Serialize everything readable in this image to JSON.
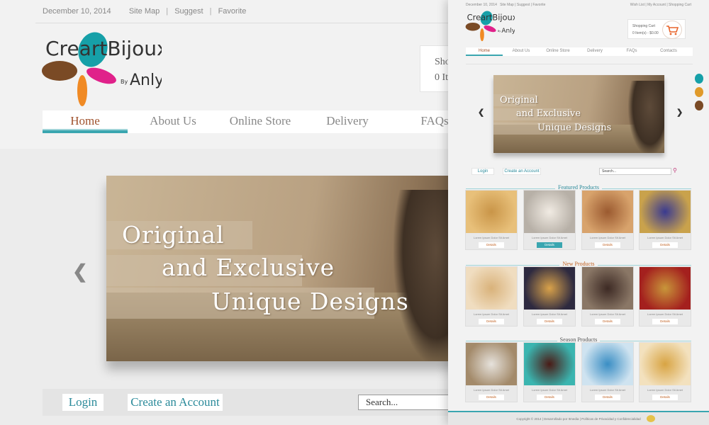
{
  "big": {
    "top_links": [
      "December 10, 2014",
      "Site Map",
      "Suggest",
      "Favorite"
    ],
    "logo": {
      "brand": "CreartBijoux",
      "by": "By",
      "author": "Anly"
    },
    "cart": {
      "label": "Shop",
      "items": "0 Ite"
    },
    "nav": [
      "Home",
      "About Us",
      "Online Store",
      "Delivery",
      "FAQs"
    ],
    "banner": {
      "line1": "Original",
      "line2": "and Exclusive",
      "line3": "Unique Designs"
    },
    "login": "Login",
    "create_account": "Create an Account",
    "search_placeholder": "Search..."
  },
  "small": {
    "top_links": [
      "December 10, 2014",
      "Site Map",
      "Suggest",
      "Favorite"
    ],
    "top_right_links": [
      "Wish List",
      "My Account",
      "Shopping Cart"
    ],
    "cart": {
      "label": "Shopping Cart",
      "items": "0 Item(s) - $0.00"
    },
    "nav": [
      "Home",
      "About Us",
      "Online Store",
      "Delivery",
      "FAQs",
      "Contacts"
    ],
    "banner": {
      "line1": "Original",
      "line2": "and Exclusive",
      "line3": "Unique Designs"
    },
    "login": "Login",
    "create_account": "Create an Account",
    "search_placeholder": "Search...",
    "sections": [
      {
        "title": "Featured Products",
        "color": "#2a8a9a",
        "products": [
          {
            "caption": "Lorem Ipsum Dolor Sit Amet",
            "details": "Details",
            "colors": [
              "#c99548",
              "#e8c07a"
            ]
          },
          {
            "caption": "Lorem Ipsum Dolor Sit Amet",
            "details": "Details",
            "colors": [
              "#f1ebe3",
              "#b7b0a7"
            ]
          },
          {
            "caption": "Lorem Ipsum Dolor Sit Amet",
            "details": "Details",
            "colors": [
              "#9b5a30",
              "#d8a36c"
            ]
          },
          {
            "caption": "Lorem Ipsum Dolor Sit Amet",
            "details": "Details",
            "colors": [
              "#3a3a90",
              "#c9a24c"
            ]
          }
        ]
      },
      {
        "title": "New Products",
        "color": "#c06020",
        "products": [
          {
            "caption": "Lorem Ipsum Dolor Sit Amet",
            "details": "Details",
            "colors": [
              "#d9b27a",
              "#f0ddc0"
            ]
          },
          {
            "caption": "Lorem Ipsum Dolor Sit Amet",
            "details": "Details",
            "colors": [
              "#d9a24a",
              "#2e2a40"
            ]
          },
          {
            "caption": "Lorem Ipsum Dolor Sit Amet",
            "details": "Details",
            "colors": [
              "#3d2a24",
              "#8a7766"
            ]
          },
          {
            "caption": "Lorem Ipsum Dolor Sit Amet",
            "details": "Details",
            "colors": [
              "#c8963a",
              "#a4201e"
            ]
          }
        ]
      },
      {
        "title": "Season Products",
        "color": "#555555",
        "products": [
          {
            "caption": "Lorem Ipsum Dolor Sit Amet",
            "details": "Details",
            "colors": [
              "#e6e2dc",
              "#a38a6a"
            ]
          },
          {
            "caption": "Lorem Ipsum Dolor Sit Amet",
            "details": "Details",
            "colors": [
              "#4a1b16",
              "#3bb5b0"
            ]
          },
          {
            "caption": "Lorem Ipsum Dolor Sit Amet",
            "details": "Details",
            "colors": [
              "#3a8ec4",
              "#cfe3f0"
            ]
          },
          {
            "caption": "Lorem Ipsum Dolor Sit Amet",
            "details": "Details",
            "colors": [
              "#d8a443",
              "#f3e1be"
            ]
          }
        ]
      }
    ],
    "footer": "Copyright © 2014 | Desarrollado por Itmedia | Políticas de Privacidad y Confidencialidad"
  },
  "colors": {
    "accent": "#3aa6b0",
    "nav_active": "#a0522d",
    "logo_teal": "#16a0a8",
    "logo_brown": "#7a4a25",
    "logo_orange": "#f08a24",
    "logo_pink": "#e0218a"
  }
}
